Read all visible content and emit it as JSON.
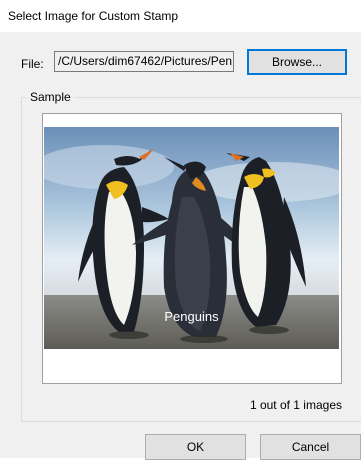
{
  "window": {
    "title": "Select Image for Custom Stamp"
  },
  "file": {
    "label": "File:",
    "value": "/C/Users/dim67462/Pictures/Pen",
    "browse_label": "Browse..."
  },
  "sample": {
    "group_label": "Sample",
    "image_caption": "Penguins",
    "count_text": "1 out of 1 images"
  },
  "buttons": {
    "ok": "OK",
    "cancel": "Cancel"
  }
}
